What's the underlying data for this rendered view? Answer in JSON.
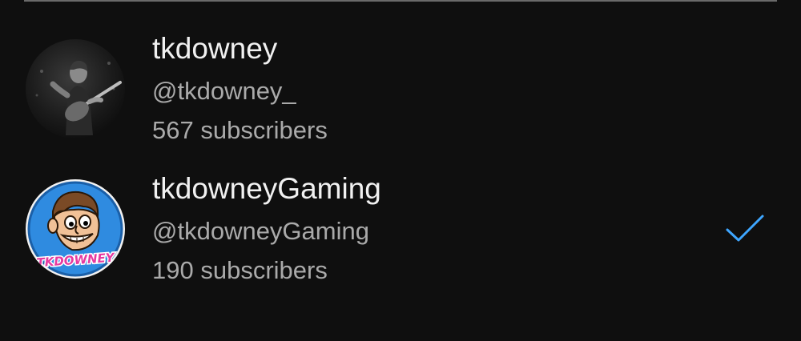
{
  "accounts": [
    {
      "name": "tkdowney",
      "handle": "@tkdowney_",
      "subscribers": "567 subscribers",
      "avatar_icon": "guitarist-photo-avatar",
      "selected": false
    },
    {
      "name": "tkdowneyGaming",
      "handle": "@tkdowneyGaming",
      "subscribers": "190 subscribers",
      "avatar_icon": "cartoon-face-logo-avatar",
      "avatar_text": "TKDOWNEY",
      "selected": true
    }
  ],
  "colors": {
    "background": "#0f0f0f",
    "primary_text": "#f1f1f1",
    "secondary_text": "#aaaaaa",
    "checkmark": "#3ea6ff",
    "avatar_logo_blue": "#2f8be0"
  }
}
